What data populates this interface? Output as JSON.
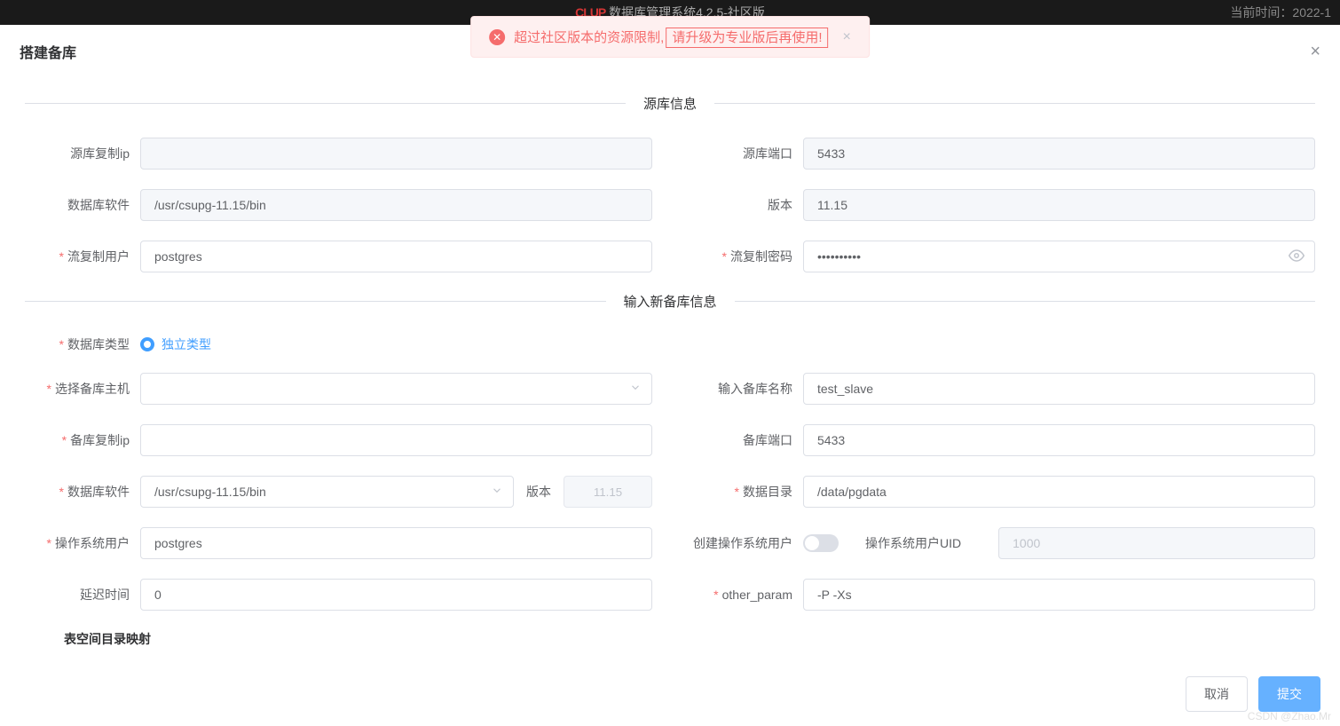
{
  "header": {
    "brand": "CLUP",
    "title": "数据库管理系统4.2.5-社区版",
    "time_prefix": "当前时间：",
    "time": "2022-1"
  },
  "alert": {
    "text1": "超过社区版本的资源限制,",
    "text2": "请升级为专业版后再使用!"
  },
  "modal": {
    "title": "搭建备库"
  },
  "sections": {
    "source": "源库信息",
    "target": "输入新备库信息",
    "tablespace": "表空间目录映射"
  },
  "labels": {
    "src_ip": "源库复制ip",
    "src_port": "源库端口",
    "db_software": "数据库软件",
    "version": "版本",
    "repl_user": "流复制用户",
    "repl_pass": "流复制密码",
    "db_type": "数据库类型",
    "radio_standalone": "独立类型",
    "select_host": "选择备库主机",
    "input_name": "输入备库名称",
    "target_ip": "备库复制ip",
    "target_port": "备库端口",
    "target_software": "数据库软件",
    "target_version": "版本",
    "data_dir": "数据目录",
    "os_user": "操作系统用户",
    "create_os_user": "创建操作系统用户",
    "os_uid": "操作系统用户UID",
    "delay": "延迟时间",
    "other_param": "other_param"
  },
  "values": {
    "src_ip": "",
    "src_port": "5433",
    "db_software": "/usr/csupg-11.15/bin",
    "version": "11.15",
    "repl_user": "postgres",
    "repl_pass": "••••••••••",
    "select_host": "",
    "input_name": "test_slave",
    "target_ip": "",
    "target_port": "5433",
    "target_software": "/usr/csupg-11.15/bin",
    "target_version": "11.15",
    "data_dir": "/data/pgdata",
    "os_user": "postgres",
    "os_uid": "1000",
    "delay": "0",
    "other_param": "-P -Xs"
  },
  "buttons": {
    "cancel": "取消",
    "submit": "提交"
  },
  "watermark": "CSDN @Zhao.Mr"
}
